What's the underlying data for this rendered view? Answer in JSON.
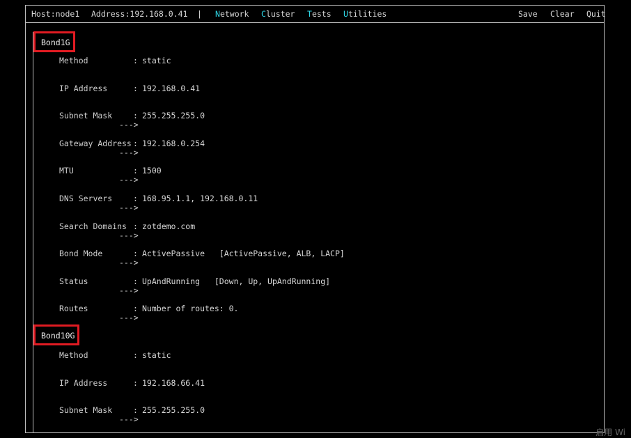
{
  "menubar": {
    "host_label": "Host:",
    "host": "node1",
    "address_label": "Address:",
    "address": "192.168.0.41",
    "separator": "|",
    "network_hk": "N",
    "network_rest": "etwork",
    "cluster_hk": "C",
    "cluster_rest": "luster",
    "tests_hk": "T",
    "tests_rest": "ests",
    "utilities_hk": "U",
    "utilities_rest": "tilities",
    "save": "Save",
    "clear": "Clear",
    "quit": "Quit"
  },
  "sections": [
    {
      "title": "Bond1G",
      "fields": [
        {
          "label": "Method",
          "value": "static",
          "options": "",
          "arrow": ""
        },
        {
          "label": "IP Address",
          "value": "192.168.0.41",
          "options": "",
          "arrow": ""
        },
        {
          "label": "Subnet Mask",
          "value": "255.255.255.0",
          "options": "",
          "arrow": "--->"
        },
        {
          "label": "Gateway Address",
          "value": "192.168.0.254",
          "options": "",
          "arrow": "--->"
        },
        {
          "label": "MTU",
          "value": "1500",
          "options": "",
          "arrow": "--->"
        },
        {
          "label": "DNS Servers",
          "value": "168.95.1.1, 192.168.0.11",
          "options": "",
          "arrow": "--->"
        },
        {
          "label": "Search Domains",
          "value": "zotdemo.com",
          "options": "",
          "arrow": "--->"
        },
        {
          "label": "Bond Mode",
          "value": "ActivePassive",
          "options": "[ActivePassive, ALB, LACP]",
          "arrow": "--->"
        },
        {
          "label": "Status",
          "value": "UpAndRunning",
          "options": "[Down, Up, UpAndRunning]",
          "arrow": "--->"
        },
        {
          "label": "Routes",
          "value": "Number of routes: 0.",
          "options": "",
          "arrow": "--->"
        }
      ]
    },
    {
      "title": "Bond10G",
      "fields": [
        {
          "label": "Method",
          "value": "static",
          "options": "",
          "arrow": ""
        },
        {
          "label": "IP Address",
          "value": "192.168.66.41",
          "options": "",
          "arrow": ""
        },
        {
          "label": "Subnet Mask",
          "value": "255.255.255.0",
          "options": "",
          "arrow": "--->"
        }
      ]
    }
  ],
  "watermark": "启用 Wi",
  "colors": {
    "hotkey": "#2fd8e8",
    "highlight_box": "#e11b22"
  }
}
